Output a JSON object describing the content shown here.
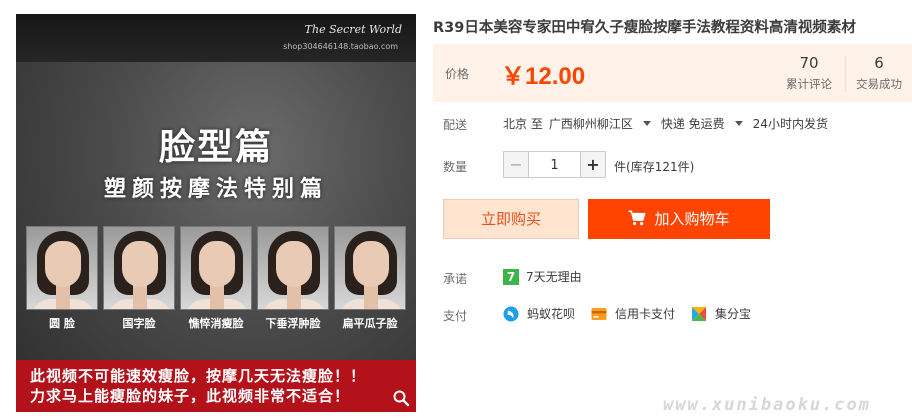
{
  "image": {
    "brand": "The Secret World",
    "shop": "shop304646148.taobao.com",
    "title": "脸型篇",
    "subtitle": "塑颜按摩法特别篇",
    "faces": [
      "圆 脸",
      "国字脸",
      "憔悴消瘦脸",
      "下垂浮肿脸",
      "扁平瓜子脸"
    ],
    "banner_lines": [
      "此视频不可能速效瘦脸，按摩几天无法瘦脸！！",
      "力求马上能瘦脸的妹子，此视频非常不适合！"
    ]
  },
  "product": {
    "title": "R39日本美容专家田中宥久子瘦脸按摩手法教程资料高清视频素材"
  },
  "price": {
    "label": "价格",
    "value": "￥12.00",
    "reviews_count": "70",
    "reviews_label": "累计评论",
    "sales_count": "6",
    "sales_label": "交易成功"
  },
  "shipping": {
    "label": "配送",
    "from": "北京 至",
    "to": "广西柳州柳江区",
    "method": "快递 免运费",
    "dispatch": "24小时内发货"
  },
  "quantity": {
    "label": "数量",
    "minus": "−",
    "value": "1",
    "plus": "+",
    "stock": "件(库存121件)"
  },
  "buttons": {
    "buy_now": "立即购买",
    "add_to_cart": "加入购物车"
  },
  "promise": {
    "label": "承诺",
    "icon_text": "7",
    "text": "7天无理由"
  },
  "payment": {
    "label": "支付",
    "methods": [
      "蚂蚁花呗",
      "信用卡支付",
      "集分宝"
    ]
  },
  "watermark": "www.xunibaoku.com",
  "colors": {
    "accent": "#ff4400",
    "price_bg": "#fff2e8",
    "banner": "#b3121b",
    "promise_green": "#3bb54a"
  },
  "icons": [
    "zoom-icon",
    "cart-icon",
    "seven-day-icon",
    "huabei-icon",
    "credit-card-icon",
    "jifenbao-icon",
    "caret-down-icon"
  ]
}
